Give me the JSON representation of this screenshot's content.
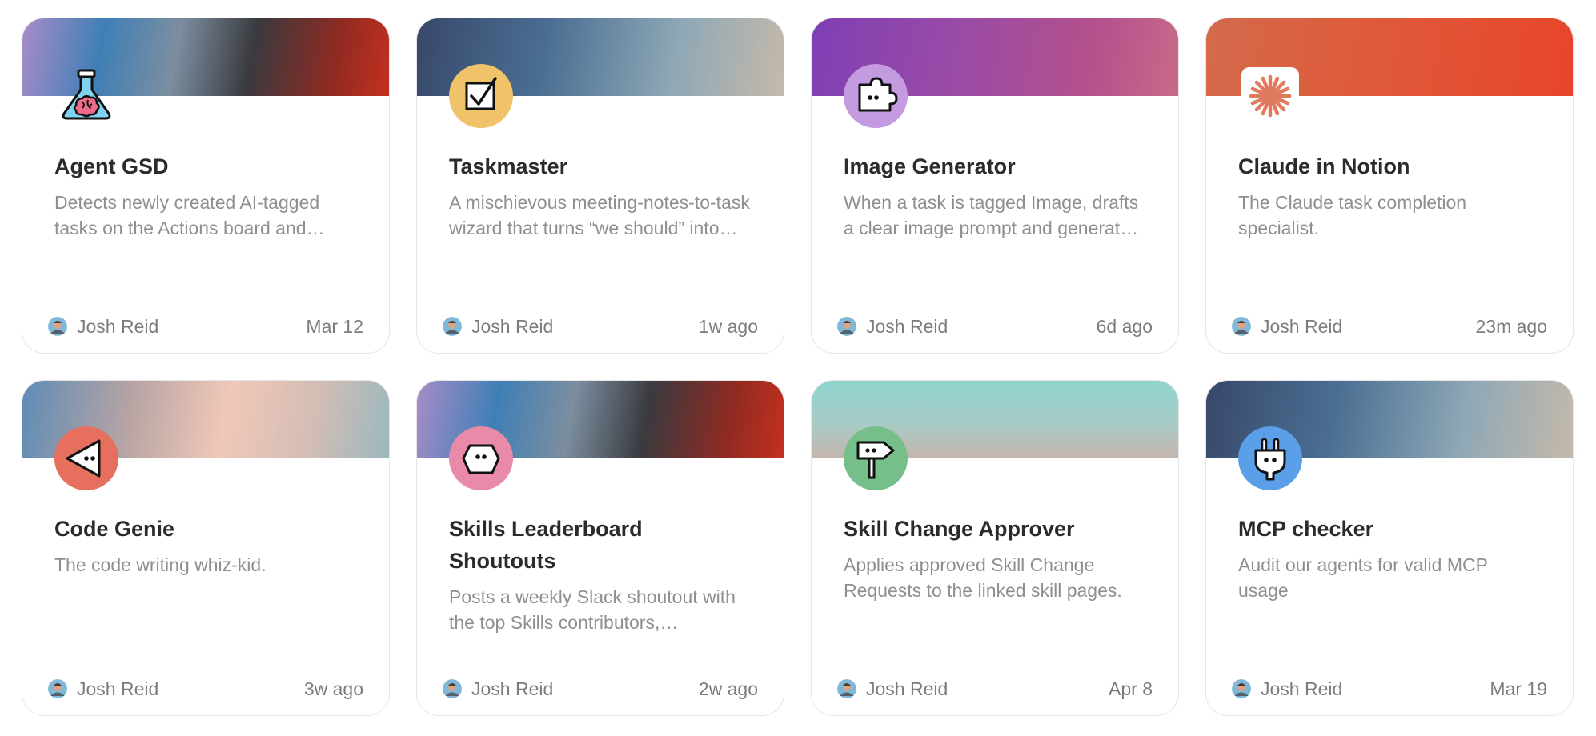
{
  "cards": [
    {
      "title": "Agent GSD",
      "description": "Detects newly created AI-tagged tasks on the Actions board and automatically kicks off the workflow.",
      "author": "Josh Reid",
      "timestamp": "Mar 12",
      "icon": "flask-brain-icon",
      "gradient": "linear-gradient(100deg, #a88cc8 0%, #3f7fb6 22%, #7c8ea0 42%, #3a3a3f 62%, #8f2a22 84%, #c4301f 100%)"
    },
    {
      "title": "Taskmaster",
      "description": "A mischievous meeting-notes-to-task wizard that turns “we should” into real tasks.",
      "author": "Josh Reid",
      "timestamp": "1w ago",
      "icon": "checkbox-icon",
      "gradient": "linear-gradient(100deg, #38486a 0%, #4a6e92 35%, #8fa8b6 70%, #c5b9aa 100%)"
    },
    {
      "title": "Image Generator",
      "description": "When a task is tagged Image, drafts a clear image prompt and generates the image.",
      "author": "Josh Reid",
      "timestamp": "6d ago",
      "icon": "puzzle-icon",
      "gradient": "linear-gradient(100deg, #7e3fb4 0%, #9a4ba6 40%, #b4508c 75%, #c86a8a 100%)"
    },
    {
      "title": "Claude in Notion",
      "description": "The Claude task completion specialist.",
      "author": "Josh Reid",
      "timestamp": "23m ago",
      "icon": "claude-asterisk-icon",
      "gradient": "linear-gradient(100deg, #d46a4c 0%, #de5a3a 45%, #e8452a 100%)"
    },
    {
      "title": "Code Genie",
      "description": "The code writing whiz-kid.",
      "author": "Josh Reid",
      "timestamp": "3w ago",
      "icon": "triangle-face-icon",
      "gradient": "linear-gradient(100deg, #5e8cb6 0%, #b8a4a4 30%, #f0c8b8 55%, #d4bdb4 78%, #9ab8bf 100%)"
    },
    {
      "title": "Skills Leaderboard Shoutouts",
      "description": "Posts a weekly Slack shoutout with the top Skills contributors, celebrating the team.",
      "author": "Josh Reid",
      "timestamp": "2w ago",
      "icon": "hexagon-face-icon",
      "gradient": "linear-gradient(100deg, #a88cc8 0%, #3f7fb6 22%, #7c8ea0 42%, #3a3a3f 62%, #8f2a22 84%, #c4301f 100%)"
    },
    {
      "title": "Skill Change Approver",
      "description": "Applies approved Skill Change Requests to the linked skill pages.",
      "author": "Josh Reid",
      "timestamp": "Apr 8",
      "icon": "signpost-icon",
      "gradient": "linear-gradient(180deg, #8fd4cf 0%, #a8cbc6 55%, #c4b5ac 100%)"
    },
    {
      "title": "MCP checker",
      "description": "Audit our agents for valid MCP usage",
      "author": "Josh Reid",
      "timestamp": "Mar 19",
      "icon": "plug-icon",
      "gradient": "linear-gradient(100deg, #38486a 0%, #4a6e92 35%, #8fa8b6 70%, #c5b9aa 100%)"
    }
  ],
  "colors": {
    "flask": "#7fd3f0",
    "brain": "#f06a8a",
    "taskmaster_badge": "#f0c26a",
    "image_badge": "#c49ae0",
    "claude_orange": "#e07a5f",
    "code_badge": "#e76f5e",
    "skills_badge": "#e88aa8",
    "approver_badge": "#76bf8a",
    "mcp_badge": "#5a9fe8"
  }
}
